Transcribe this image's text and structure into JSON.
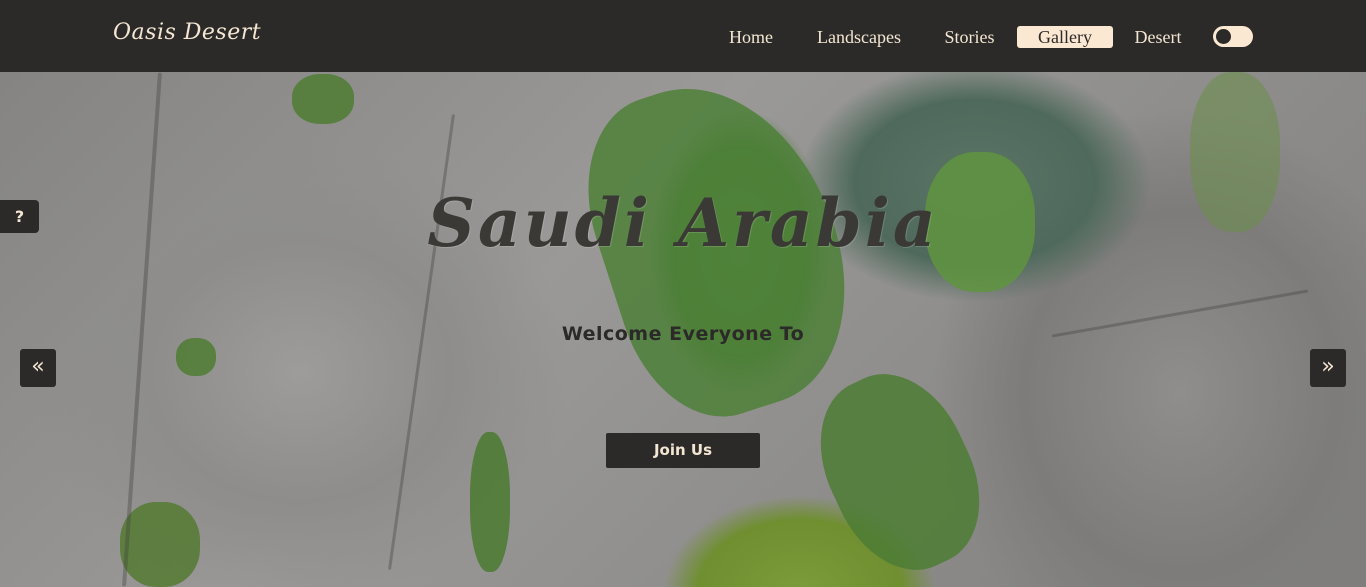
{
  "nav": {
    "logo": "Oasis Desert",
    "links": [
      {
        "label": "Home"
      },
      {
        "label": "Landscapes"
      },
      {
        "label": "Stories"
      },
      {
        "label": "Gallery"
      },
      {
        "label": "Desert"
      }
    ],
    "active": "Gallery",
    "toggle_icon": "theme-toggle-icon"
  },
  "hero": {
    "title": "Saudi Arabia",
    "subtitle": "Welcome Everyone To",
    "cta_label": "Join Us"
  },
  "controls": {
    "help_label": "?",
    "prev_label": "«",
    "next_label": "»"
  },
  "colors": {
    "nav_bg": "#2b2a28",
    "accent": "#fbe8d2",
    "text_light": "#f3e6d2"
  }
}
